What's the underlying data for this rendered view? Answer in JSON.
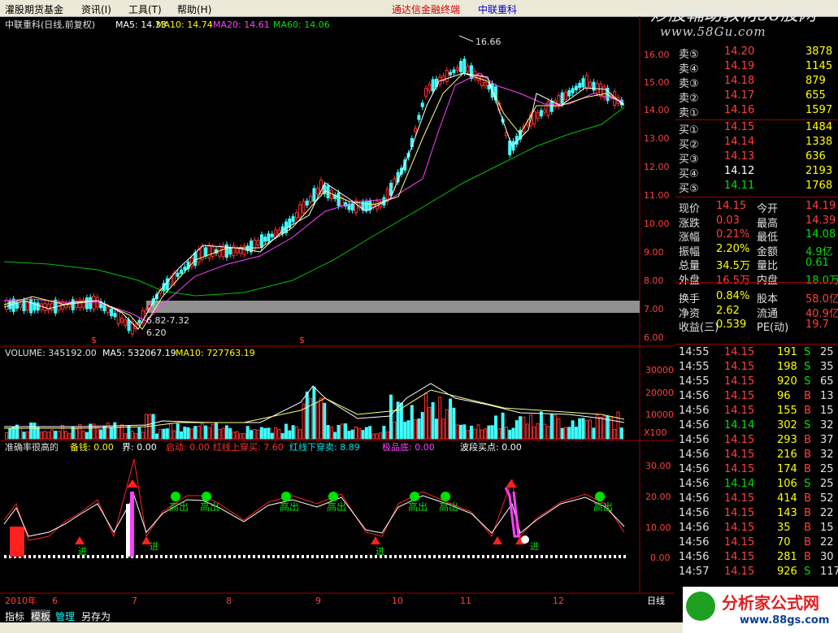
{
  "menu": {
    "items": [
      "灌股期货基金",
      "资讯(I)",
      "工具(T)",
      "帮助(H)"
    ],
    "center_title": "通达信金融终端",
    "center_stock": "中联重科"
  },
  "watermark": {
    "line1": "炒股輔助教材58股网",
    "line2": "www.58Gu.com"
  },
  "main_chart": {
    "header": "中联重科(日线,前复权)",
    "ma5_label": "MA5: 14.33",
    "ma10_label": "MA10: 14.74",
    "ma20_label": "MA20: 14.61",
    "ma60_label": "MA60: 14.06",
    "annotations": {
      "high": "16.66",
      "low": "6.20",
      "range": "6.82-7.32"
    },
    "markers": [
      "$",
      "$"
    ],
    "price_ticks": [
      "16.00",
      "15.00",
      "14.00",
      "13.00",
      "12.00",
      "11.00",
      "10.00",
      "9.00",
      "8.00",
      "7.00",
      "6.00"
    ]
  },
  "volume_chart": {
    "header": "VOLUME: 345192.00",
    "ma5_label": "MA5: 532067.19",
    "ma10_label": "MA10: 727763.19",
    "ticks": [
      "30000",
      "20000",
      "10000"
    ],
    "unit": "X100"
  },
  "indicator_chart": {
    "name": "准确率很高的",
    "fields": [
      {
        "label": "备钱: 0.00",
        "color": "#ffff00"
      },
      {
        "label": "界: 0.00",
        "color": "#ffffff"
      },
      {
        "label": "启动: 0.00",
        "color": "#ff3030"
      },
      {
        "label": "红线上穿买: 7.60",
        "color": "#ff3030"
      },
      {
        "label": "红线下穿卖: 8.89",
        "color": "#00e0e0"
      },
      {
        "label": "极品底: 0.00",
        "color": "#ff40ff"
      },
      {
        "label": "波段买点: 0.00",
        "color": "#ffffff"
      }
    ],
    "ticks": [
      "30.00",
      "20.00",
      "10.00",
      "0.00"
    ],
    "sell_label": "高出",
    "buy_label": "进"
  },
  "x_axis": {
    "labels": [
      "2010年",
      "6",
      "7",
      "8",
      "9",
      "10",
      "11",
      "12"
    ],
    "period": "日线"
  },
  "order_book": {
    "asks": [
      {
        "label": "卖⑤",
        "price": "14.20",
        "vol": "3878"
      },
      {
        "label": "卖④",
        "price": "14.19",
        "vol": "1145"
      },
      {
        "label": "卖③",
        "price": "14.18",
        "vol": "879"
      },
      {
        "label": "卖②",
        "price": "14.17",
        "vol": "655"
      },
      {
        "label": "卖①",
        "price": "14.16",
        "vol": "1597"
      }
    ],
    "bids": [
      {
        "label": "买①",
        "price": "14.15",
        "vol": "1484"
      },
      {
        "label": "买②",
        "price": "14.14",
        "vol": "1338"
      },
      {
        "label": "买③",
        "price": "14.13",
        "vol": "636"
      },
      {
        "label": "买④",
        "price": "14.12",
        "vol": "2193"
      },
      {
        "label": "买⑤",
        "price": "14.11",
        "vol": "1768"
      }
    ]
  },
  "stats": [
    {
      "l1": "现价",
      "v1": "14.15",
      "l2": "今开",
      "v2": "14.19"
    },
    {
      "l1": "涨跌",
      "v1": "0.03",
      "l2": "最高",
      "v2": "14.39"
    },
    {
      "l1": "涨幅",
      "v1": "0.21%",
      "l2": "最低",
      "v2": "14.08"
    },
    {
      "l1": "振幅",
      "v1": "2.20%",
      "l2": "金额",
      "v2": "4.9亿"
    },
    {
      "l1": "总量",
      "v1": "34.5万",
      "l2": "量比",
      "v2": "0.61"
    },
    {
      "l1": "外盘",
      "v1": "16.5万",
      "l2": "内盘",
      "v2": "18.0万"
    },
    {
      "l1": "换手",
      "v1": "0.84%",
      "l2": "股本",
      "v2": "58.0亿"
    },
    {
      "l1": "净资",
      "v1": "2.62",
      "l2": "流通",
      "v2": "40.9亿"
    },
    {
      "l1": "收益(三)",
      "v1": "0.539",
      "l2": "PE(动)",
      "v2": "19.7"
    }
  ],
  "ticks_list": [
    {
      "t": "14:55",
      "p": "14.15",
      "v": "191",
      "d": "S",
      "n": "25"
    },
    {
      "t": "14:55",
      "p": "14.15",
      "v": "198",
      "d": "S",
      "n": "35"
    },
    {
      "t": "14:55",
      "p": "14.15",
      "v": "920",
      "d": "S",
      "n": "65"
    },
    {
      "t": "14:56",
      "p": "14.15",
      "v": "96",
      "d": "B",
      "n": "13"
    },
    {
      "t": "14:56",
      "p": "14.15",
      "v": "155",
      "d": "B",
      "n": "15"
    },
    {
      "t": "14:56",
      "p": "14.14",
      "v": "302",
      "d": "S",
      "n": "32"
    },
    {
      "t": "14:56",
      "p": "14.15",
      "v": "293",
      "d": "B",
      "n": "37"
    },
    {
      "t": "14:56",
      "p": "14.15",
      "v": "216",
      "d": "B",
      "n": "32"
    },
    {
      "t": "14:56",
      "p": "14.15",
      "v": "174",
      "d": "B",
      "n": "25"
    },
    {
      "t": "14:56",
      "p": "14.14",
      "v": "106",
      "d": "S",
      "n": "25"
    },
    {
      "t": "14:56",
      "p": "14.15",
      "v": "414",
      "d": "B",
      "n": "52"
    },
    {
      "t": "14:56",
      "p": "14.15",
      "v": "143",
      "d": "B",
      "n": "22"
    },
    {
      "t": "14:56",
      "p": "14.15",
      "v": "35",
      "d": "B",
      "n": "15"
    },
    {
      "t": "14:56",
      "p": "14.15",
      "v": "70",
      "d": "B",
      "n": "22"
    },
    {
      "t": "14:56",
      "p": "14.15",
      "v": "281",
      "d": "B",
      "n": "30"
    },
    {
      "t": "14:57",
      "p": "14.15",
      "v": "926",
      "d": "S",
      "n": "117"
    }
  ],
  "tabs": [
    "指标",
    "模板",
    "管理",
    "另存为"
  ],
  "logo": {
    "text": "分析家公式网",
    "url": "www.88gs.com"
  }
}
